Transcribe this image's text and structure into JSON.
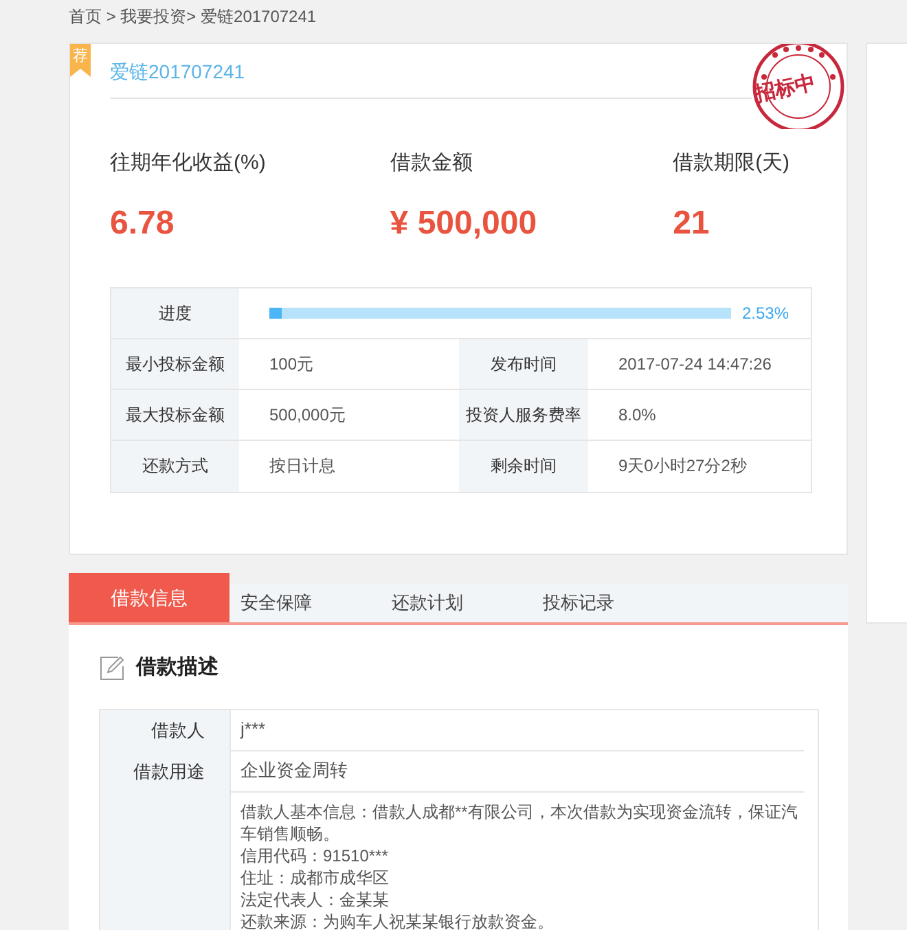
{
  "breadcrumb": "首页 > 我要投资> 爱链201707241",
  "loan": {
    "badge": "荐",
    "title": "爱链201707241",
    "stamp": "招标中"
  },
  "stats": [
    {
      "label": "往期年化收益(%)",
      "value": "6.78"
    },
    {
      "label": "借款金额",
      "value": "¥ 500,000"
    },
    {
      "label": "借款期限(天)",
      "value": "21"
    }
  ],
  "progress": {
    "label": "进度",
    "level": 0.0253,
    "reading": "2.53%"
  },
  "details": [
    {
      "label": "最小投标金额",
      "value": "100元",
      "label_2": "发布时间",
      "value_2": "2017-07-24 14:47:26"
    },
    {
      "label": "最大投标金额",
      "value": "500,000元",
      "label_2": "投资人服务费率",
      "value_2": "8.0%"
    },
    {
      "label": "还款方式",
      "value": "按日计息",
      "label_2": "剩余时间",
      "value_2": "9天0小时27分2秒"
    }
  ],
  "tabs": [
    {
      "label": "借款信息",
      "selected": true
    },
    {
      "label": "安全保障",
      "selected": false
    },
    {
      "label": "还款计划",
      "selected": false
    },
    {
      "label": "投标记录",
      "selected": false
    }
  ],
  "section": {
    "title": "借款描述"
  },
  "description": [
    {
      "label": "借款人",
      "lines": [
        "j***"
      ]
    },
    {
      "label": "借款用途",
      "lines": [
        "企业资金周转"
      ]
    },
    {
      "lines": [
        "借款人基本信息：借款人成都**有限公司，本次借款为实现资金流转，保证汽车销售顺畅。",
        "信用代码：91510***",
        "住址：成都市成华区",
        "法定代表人：金某某",
        "还款来源：为购车人祝某某银行放款资金。"
      ]
    }
  ]
}
